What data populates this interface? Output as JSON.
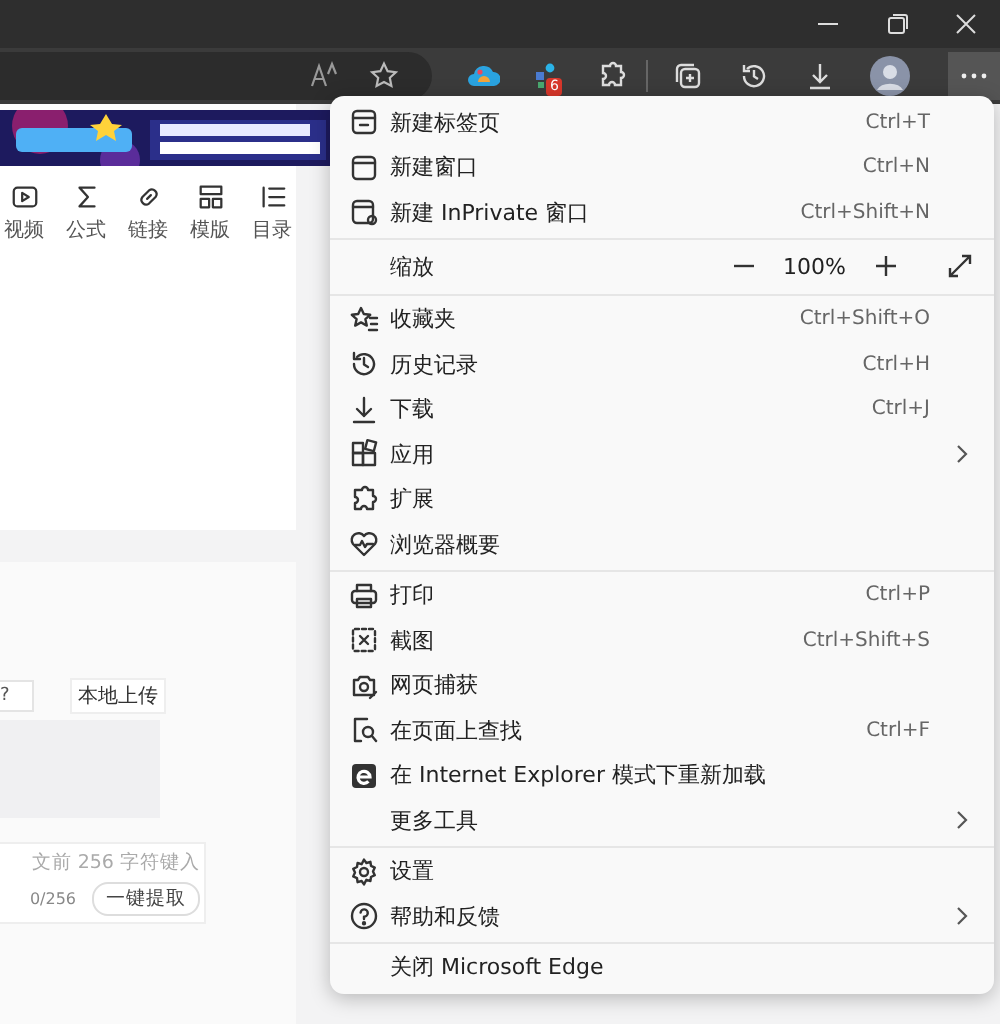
{
  "toolbar": {
    "extension_badge": "6"
  },
  "editor_toolbar": [
    {
      "kind": "video",
      "label": "视频"
    },
    {
      "kind": "formula",
      "label": "公式"
    },
    {
      "kind": "link",
      "label": "链接"
    },
    {
      "kind": "template",
      "label": "模版"
    },
    {
      "kind": "outline",
      "label": "目录"
    }
  ],
  "upload_form": {
    "url_field": {
      "value": "?"
    },
    "upload_button": "本地上传",
    "summary": {
      "placeholder": "文前 256 字符键入",
      "count": "0/256",
      "extract_button": "一键提取"
    }
  },
  "menu": {
    "sections": [
      [
        {
          "kind": "item",
          "label": "新建标签页",
          "shortcut": "Ctrl+T",
          "submenu": false
        },
        {
          "kind": "item",
          "label": "新建窗口",
          "shortcut": "Ctrl+N",
          "submenu": false
        },
        {
          "kind": "item",
          "label": "新建 InPrivate 窗口",
          "shortcut": "Ctrl+Shift+N",
          "submenu": false
        }
      ],
      [
        {
          "kind": "zoom",
          "label": "缩放",
          "value": "100%"
        }
      ],
      [
        {
          "kind": "item",
          "label": "收藏夹",
          "shortcut": "Ctrl+Shift+O",
          "submenu": false
        },
        {
          "kind": "item",
          "label": "历史记录",
          "shortcut": "Ctrl+H",
          "submenu": false
        },
        {
          "kind": "item",
          "label": "下载",
          "shortcut": "Ctrl+J",
          "submenu": false
        },
        {
          "kind": "item",
          "label": "应用",
          "submenu": true
        },
        {
          "kind": "item",
          "label": "扩展",
          "submenu": false
        },
        {
          "kind": "item",
          "label": "浏览器概要",
          "submenu": false
        }
      ],
      [
        {
          "kind": "item",
          "label": "打印",
          "shortcut": "Ctrl+P",
          "submenu": false
        },
        {
          "kind": "item",
          "label": "截图",
          "shortcut": "Ctrl+Shift+S",
          "submenu": false
        },
        {
          "kind": "item",
          "label": "网页捕获",
          "submenu": false
        },
        {
          "kind": "item",
          "label": "在页面上查找",
          "shortcut": "Ctrl+F",
          "submenu": false
        },
        {
          "kind": "item",
          "label": "在 Internet Explorer 模式下重新加载",
          "submenu": false
        },
        {
          "kind": "item",
          "label": "更多工具",
          "submenu": true
        }
      ],
      [
        {
          "kind": "item",
          "label": "设置",
          "submenu": false
        },
        {
          "kind": "item",
          "label": "帮助和反馈",
          "submenu": true
        }
      ],
      [
        {
          "kind": "item",
          "label": "关闭 Microsoft Edge",
          "submenu": false
        }
      ]
    ]
  }
}
